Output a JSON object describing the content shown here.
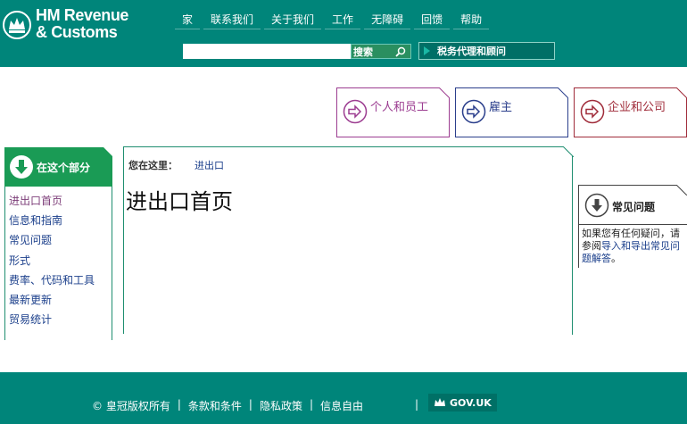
{
  "colors": {
    "header_bg": "#00857a",
    "individuals": "#9c3d91",
    "employers": "#2b3f8c",
    "businesses": "#a02c3a",
    "sidebar_head": "#1a9b55",
    "link": "#1b3f8b"
  },
  "header": {
    "logo_line1": "HM Revenue",
    "logo_line2": "& Customs",
    "nav": [
      "家",
      "联系我们",
      "关于我们",
      "工作",
      "无障碍",
      "回馈",
      "帮助"
    ],
    "search_placeholder": "",
    "search_label": "搜索",
    "agents_label": "税务代理和顾问"
  },
  "audiences": [
    "个人和员工",
    "雇主",
    "企业和公司"
  ],
  "sidebar": {
    "title": "在这个部分",
    "items": [
      "进出口首页",
      "信息和指南",
      "常见问题",
      "形式",
      "费率、代码和工具",
      "最新更新",
      "贸易统计"
    ]
  },
  "main": {
    "breadcrumb_label": "您在这里：",
    "breadcrumb_link": "进出口",
    "title": "进出口首页"
  },
  "faq": {
    "title": "常见问题",
    "text": "如果您有任何疑问，请参阅",
    "link": "导入和导出常见问题解答",
    "suffix": "。"
  },
  "footer": {
    "links": [
      "© 皇冠版权所有",
      "条款和条件",
      "隐私政策",
      "信息自由"
    ],
    "gov": "GOV.UK"
  }
}
